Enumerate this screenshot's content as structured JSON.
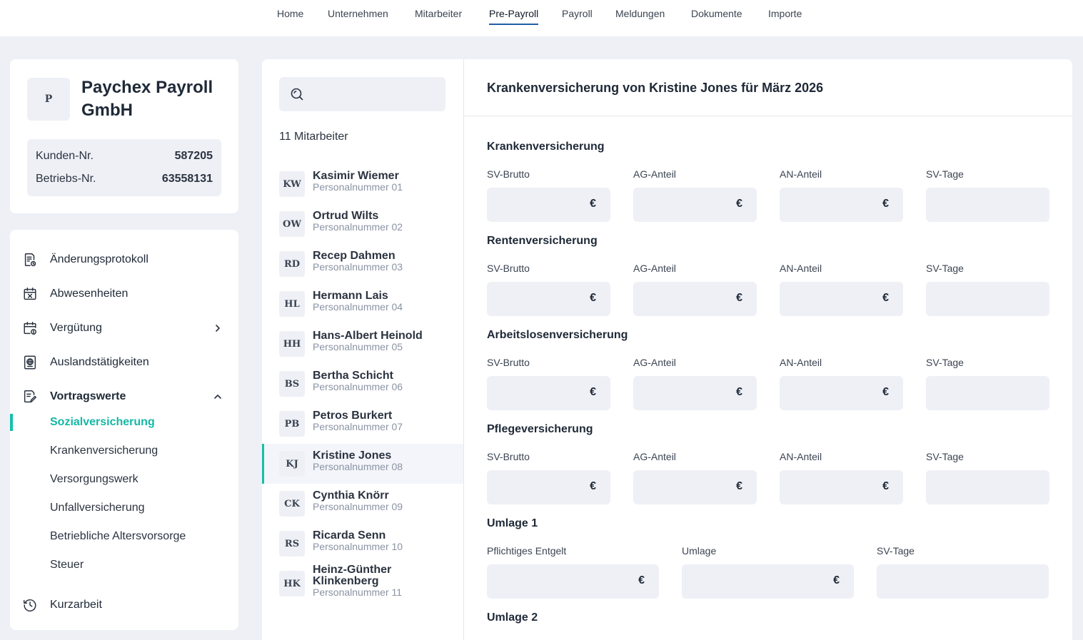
{
  "nav": {
    "items": [
      "Home",
      "Unternehmen",
      "Mitarbeiter",
      "Pre-Payroll",
      "Payroll",
      "Meldungen",
      "Dokumente",
      "Importe"
    ],
    "active": "Pre-Payroll"
  },
  "company": {
    "logo_letter": "P",
    "name": "Paychex Payroll GmbH",
    "kunden_label": "Kunden-Nr.",
    "kunden_value": "587205",
    "betriebs_label": "Betriebs-Nr.",
    "betriebs_value": "63558131"
  },
  "menu": {
    "items": [
      {
        "label": "Änderungsprotokoll",
        "icon": "document-log-icon"
      },
      {
        "label": "Abwesenheiten",
        "icon": "calendar-x-icon"
      },
      {
        "label": "Vergütung",
        "icon": "calendar-money-icon",
        "chevron": "right"
      },
      {
        "label": "Auslandstätigkeiten",
        "icon": "passport-globe-icon"
      },
      {
        "label": "Vortragswerte",
        "icon": "document-edit-icon",
        "chevron": "up",
        "expanded": true
      }
    ],
    "sub_items": [
      "Sozialversicherung",
      "Krankenversicherung",
      "Versorgungswerk",
      "Unfallversicherung",
      "Betriebliche Altersvorsorge",
      "Steuer"
    ],
    "sub_active": "Sozialversicherung",
    "bottom_item": {
      "label": "Kurzarbeit",
      "icon": "clock-icon"
    }
  },
  "employees": {
    "search_placeholder": "",
    "count_label": "11 Mitarbeiter",
    "list": [
      {
        "initials": "KW",
        "name": "Kasimir Wiemer",
        "number": "Personalnummer 01"
      },
      {
        "initials": "OW",
        "name": "Ortrud Wilts",
        "number": "Personalnummer 02"
      },
      {
        "initials": "RD",
        "name": "Recep Dahmen",
        "number": "Personalnummer 03"
      },
      {
        "initials": "HL",
        "name": "Hermann Lais",
        "number": "Personalnummer 04"
      },
      {
        "initials": "HH",
        "name": "Hans-Albert Heinold",
        "number": "Personalnummer 05"
      },
      {
        "initials": "BS",
        "name": "Bertha Schicht",
        "number": "Personalnummer 06"
      },
      {
        "initials": "PB",
        "name": "Petros Burkert",
        "number": "Personalnummer 07"
      },
      {
        "initials": "KJ",
        "name": "Kristine Jones",
        "number": "Personalnummer 08",
        "selected": true
      },
      {
        "initials": "CK",
        "name": "Cynthia Knörr",
        "number": "Personalnummer 09"
      },
      {
        "initials": "RS",
        "name": "Ricarda Senn",
        "number": "Personalnummer 10"
      },
      {
        "initials": "HK",
        "name": "Heinz-Günther Klinkenberg",
        "number": "Personalnummer 11"
      }
    ]
  },
  "detail": {
    "title": "Krankenversicherung von Kristine Jones für März 2026",
    "currency": "€",
    "sections": [
      {
        "title": "Krankenversicherung",
        "fields": [
          {
            "label": "SV-Brutto",
            "value": "",
            "unit": "€"
          },
          {
            "label": "AG-Anteil",
            "value": "",
            "unit": "€"
          },
          {
            "label": "AN-Anteil",
            "value": "",
            "unit": "€"
          },
          {
            "label": "SV-Tage",
            "value": "",
            "unit": ""
          }
        ]
      },
      {
        "title": "Rentenversicherung",
        "fields": [
          {
            "label": "SV-Brutto",
            "value": "",
            "unit": "€"
          },
          {
            "label": "AG-Anteil",
            "value": "",
            "unit": "€"
          },
          {
            "label": "AN-Anteil",
            "value": "",
            "unit": "€"
          },
          {
            "label": "SV-Tage",
            "value": "",
            "unit": ""
          }
        ]
      },
      {
        "title": "Arbeitslosenversicherung",
        "fields": [
          {
            "label": "SV-Brutto",
            "value": "",
            "unit": "€"
          },
          {
            "label": "AG-Anteil",
            "value": "",
            "unit": "€"
          },
          {
            "label": "AN-Anteil",
            "value": "",
            "unit": "€"
          },
          {
            "label": "SV-Tage",
            "value": "",
            "unit": ""
          }
        ]
      },
      {
        "title": "Pflegeversicherung",
        "fields": [
          {
            "label": "SV-Brutto",
            "value": "",
            "unit": "€"
          },
          {
            "label": "AG-Anteil",
            "value": "",
            "unit": "€"
          },
          {
            "label": "AN-Anteil",
            "value": "",
            "unit": "€"
          },
          {
            "label": "SV-Tage",
            "value": "",
            "unit": ""
          }
        ]
      },
      {
        "title": "Umlage 1",
        "fields": [
          {
            "label": "Pflichtiges Entgelt",
            "value": "",
            "unit": "€"
          },
          {
            "label": "Umlage",
            "value": "",
            "unit": "€"
          },
          {
            "label": "SV-Tage",
            "value": "",
            "unit": ""
          }
        ]
      },
      {
        "title": "Umlage 2",
        "fields": []
      }
    ]
  }
}
